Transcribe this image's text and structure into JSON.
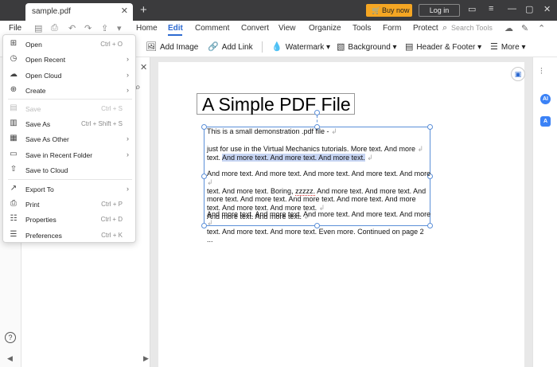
{
  "titlebar": {
    "tab_title": "sample.pdf",
    "buy_label": "Buy now",
    "login_label": "Log in"
  },
  "menubar": {
    "file": "File",
    "items": [
      "Home",
      "Edit",
      "Comment",
      "Convert",
      "View",
      "Organize",
      "Tools",
      "Form",
      "Protect"
    ],
    "active": "Edit",
    "search_placeholder": "Search Tools"
  },
  "toolbar": {
    "add_image": "Add Image",
    "add_link": "Add Link",
    "watermark": "Watermark",
    "background": "Background",
    "header_footer": "Header & Footer",
    "more": "More"
  },
  "file_menu": {
    "items": [
      {
        "label": "Open",
        "shortcut": "Ctrl + O",
        "submenu": false,
        "disabled": false,
        "icon": "plus-box-icon"
      },
      {
        "label": "Open Recent",
        "shortcut": "",
        "submenu": true,
        "disabled": false,
        "icon": "clock-icon"
      },
      {
        "label": "Open Cloud",
        "shortcut": "",
        "submenu": true,
        "disabled": false,
        "icon": "cloud-icon"
      },
      {
        "label": "Create",
        "shortcut": "",
        "submenu": true,
        "disabled": false,
        "icon": "create-icon"
      },
      {
        "label": "Save",
        "shortcut": "Ctrl + S",
        "submenu": false,
        "disabled": true,
        "icon": "save-icon"
      },
      {
        "label": "Save As",
        "shortcut": "Ctrl + Shift + S",
        "submenu": false,
        "disabled": false,
        "icon": "save-as-icon"
      },
      {
        "label": "Save As Other",
        "shortcut": "",
        "submenu": true,
        "disabled": false,
        "icon": "save-other-icon"
      },
      {
        "label": "Save in Recent Folder",
        "shortcut": "",
        "submenu": true,
        "disabled": false,
        "icon": "folder-icon"
      },
      {
        "label": "Save to Cloud",
        "shortcut": "",
        "submenu": false,
        "disabled": false,
        "icon": "cloud-upload-icon"
      },
      {
        "label": "Export To",
        "shortcut": "",
        "submenu": true,
        "disabled": false,
        "icon": "export-icon"
      },
      {
        "label": "Print",
        "shortcut": "Ctrl + P",
        "submenu": false,
        "disabled": false,
        "icon": "print-icon"
      },
      {
        "label": "Properties",
        "shortcut": "Ctrl + D",
        "submenu": false,
        "disabled": false,
        "icon": "properties-icon"
      },
      {
        "label": "Preferences",
        "shortcut": "Ctrl + K",
        "submenu": false,
        "disabled": false,
        "icon": "preferences-icon"
      }
    ]
  },
  "document": {
    "title": "A Simple PDF File",
    "line1": "This is a small demonstration .pdf file -",
    "p2a": "just for use in the Virtual Mechanics tutorials. More text. And more",
    "p2b_plain": "text.",
    "p2b_hl": "And more text. And more text. And more text.",
    "p3a": "And more text. And more text. And more text. And more text. And more",
    "p3b_pre": "text. And more text. Boring,",
    "p3b_zz": "zzzzz.",
    "p3b_post": "And more text. And more text. And",
    "p3c": "more text. And more text. And more text. And more text. And more",
    "p3d": "text. And more text. And more text.",
    "p3e": "And more text. And more text.",
    "p4a": "And more text. And more text. And more text. And more text. And more",
    "p4b": "text. And more text. And more text. Even more. Continued on page 2 ..."
  },
  "colors": {
    "accent": "#2d6ad1",
    "buy": "#f5a623",
    "selection": "#5b8fd8"
  }
}
